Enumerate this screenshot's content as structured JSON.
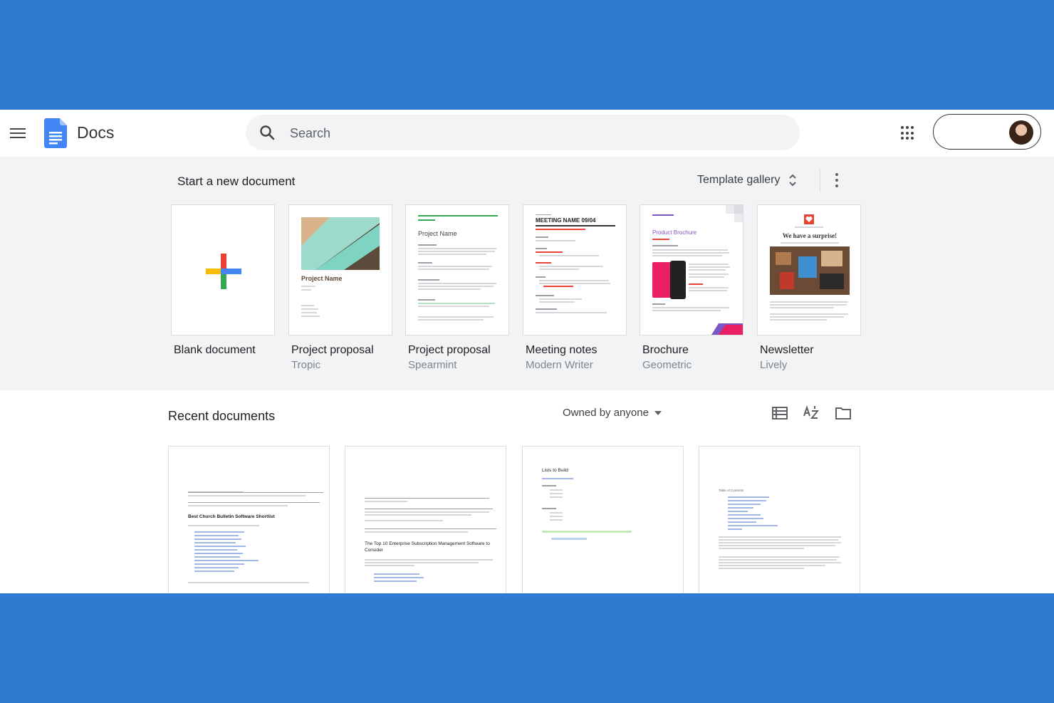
{
  "header": {
    "app_name": "Docs",
    "search_placeholder": "Search"
  },
  "templates": {
    "heading": "Start a new document",
    "gallery_label": "Template gallery",
    "items": [
      {
        "title": "Blank document",
        "subtitle": ""
      },
      {
        "title": "Project proposal",
        "subtitle": "Tropic",
        "thumb_text": "Project Name"
      },
      {
        "title": "Project proposal",
        "subtitle": "Spearmint",
        "thumb_text": "Project Name"
      },
      {
        "title": "Meeting notes",
        "subtitle": "Modern Writer",
        "thumb_text": "MEETING NAME 09/04"
      },
      {
        "title": "Brochure",
        "subtitle": "Geometric",
        "thumb_text": "Product Brochure"
      },
      {
        "title": "Newsletter",
        "subtitle": "Lively",
        "thumb_text": "We have a surprise!"
      }
    ]
  },
  "recent": {
    "heading": "Recent documents",
    "owner_filter": "Owned by anyone",
    "docs": [
      {
        "preview_heading": "Best Church Bulletin Software Shortlist"
      },
      {
        "preview_heading": "The Top 10 Enterprise Subscription Management Software to Consider"
      },
      {
        "preview_heading": "Lists to Build"
      },
      {
        "preview_heading": "Table of Contents"
      }
    ]
  },
  "colors": {
    "background": "#2f7bd2",
    "docs_blue": "#4285f4",
    "plus_red": "#ea4335",
    "plus_yellow": "#fbbc04",
    "plus_green": "#34a853"
  }
}
